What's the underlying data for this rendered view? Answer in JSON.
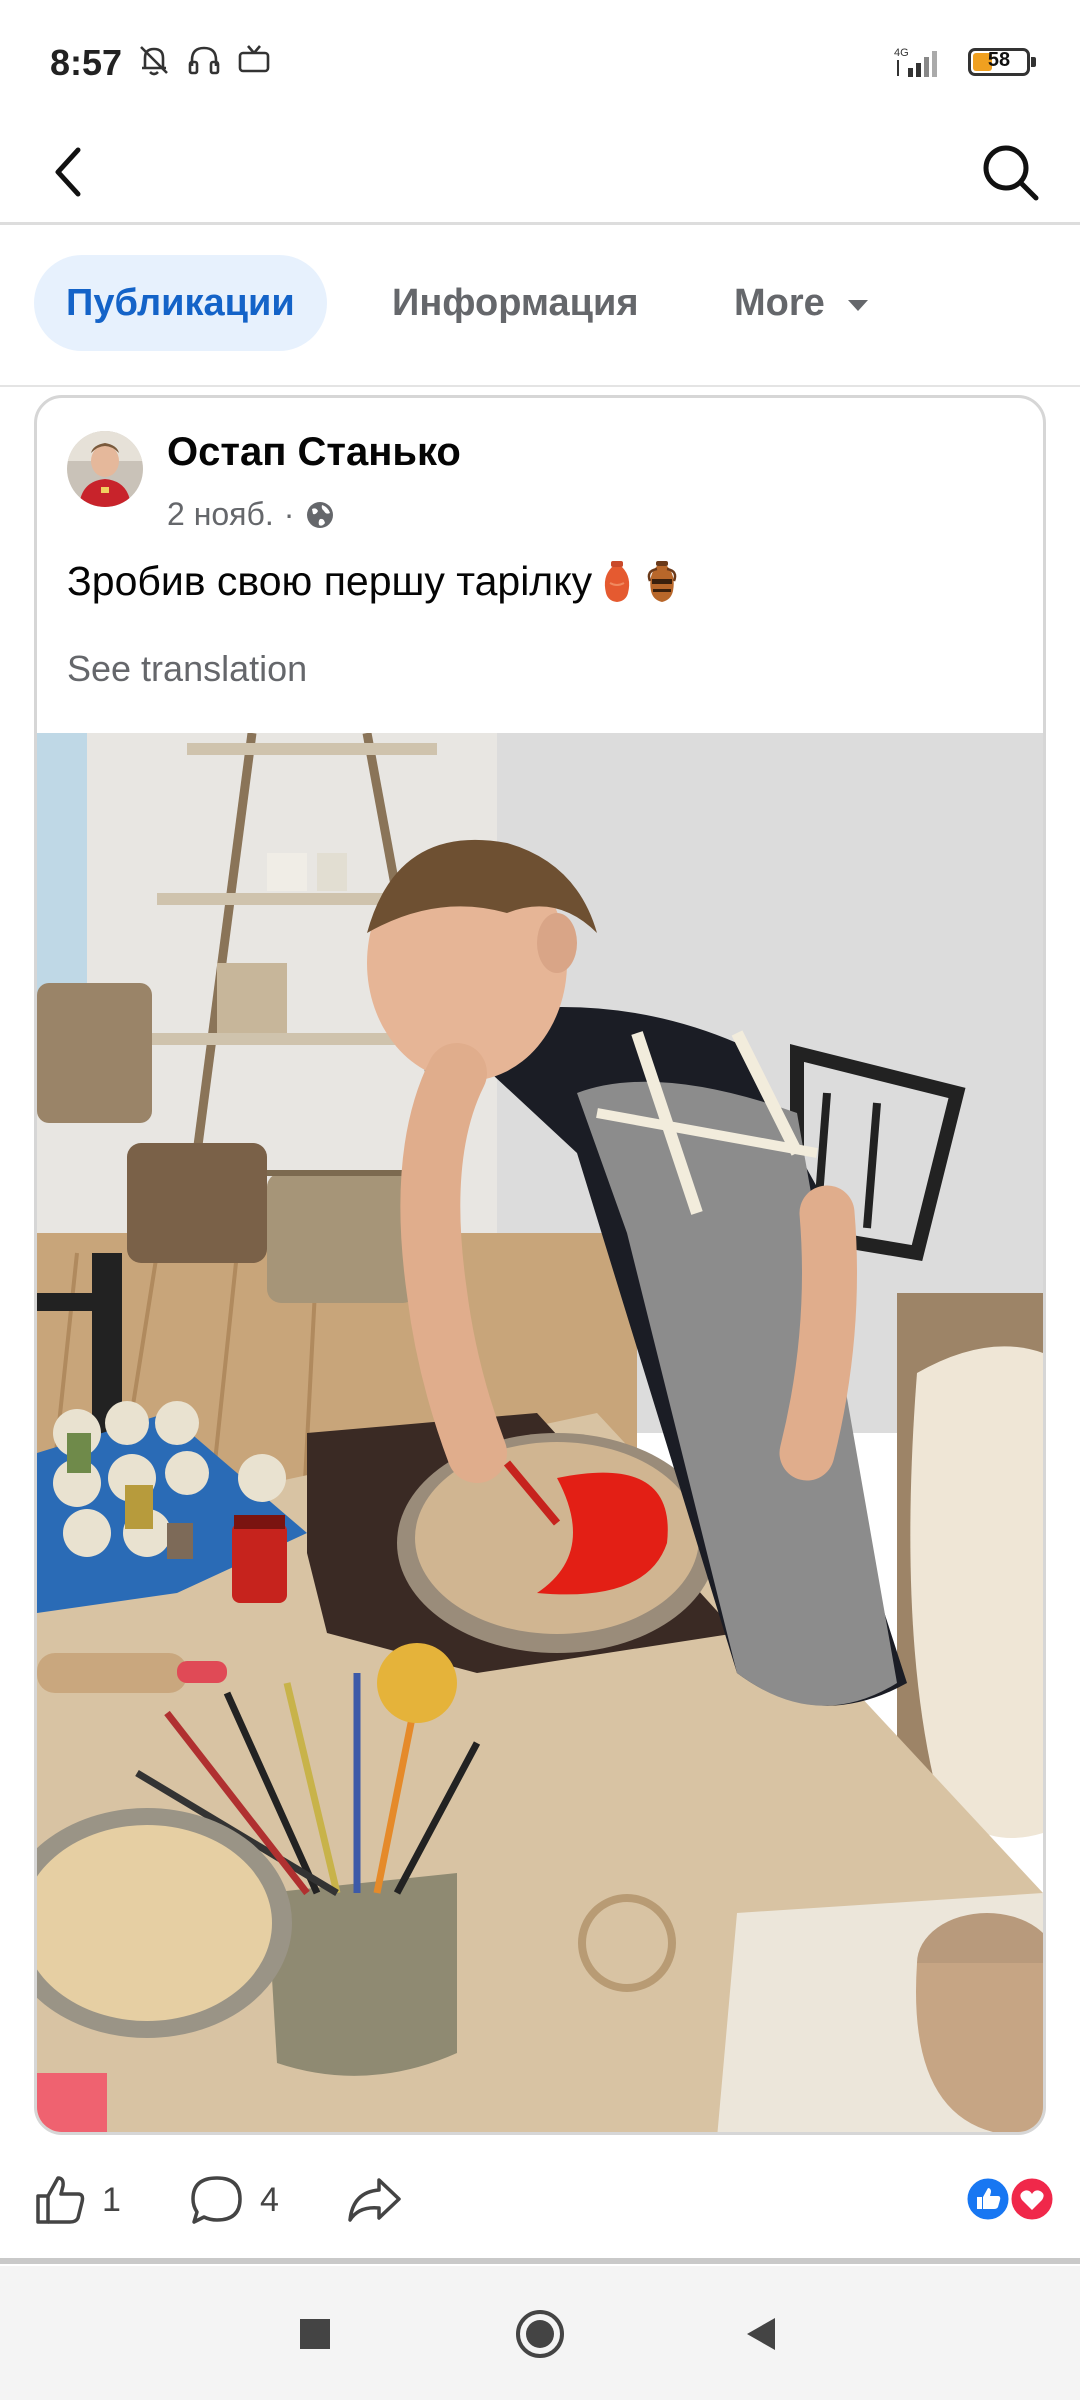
{
  "status_bar": {
    "time": "8:57",
    "network": "4G",
    "battery": "58",
    "icons": [
      "bell-muted-icon",
      "headphones-icon",
      "tv-icon"
    ]
  },
  "top_bar": {
    "icons": [
      "back-arrow-icon",
      "search-icon"
    ]
  },
  "tabs": [
    {
      "label": "Публикации",
      "active": true
    },
    {
      "label": "Информация",
      "active": false
    },
    {
      "label": "More",
      "active": false
    }
  ],
  "post": {
    "author": "Остап Станько",
    "date": "2 нояб.",
    "separator": "·",
    "audience_icon": "globe-icon",
    "text": "Зробив свою першу тарілку",
    "emojis": [
      "vase-icon",
      "amphora-icon"
    ],
    "see_translation": "See translation"
  },
  "actions": {
    "like_count": "1",
    "comment_count": "4",
    "icons": [
      "thumbs-up-icon",
      "comment-icon",
      "share-icon"
    ],
    "reactions": [
      "like-reaction-icon",
      "love-reaction-icon"
    ]
  },
  "colors": {
    "accent": "#1463c8",
    "tab_active_bg": "#e7f1fd",
    "like_blue": "#1877f2",
    "love_red": "#f0284a"
  },
  "nav_bar": {
    "icons": [
      "recents-square-icon",
      "home-circle-icon",
      "back-triangle-icon"
    ]
  }
}
